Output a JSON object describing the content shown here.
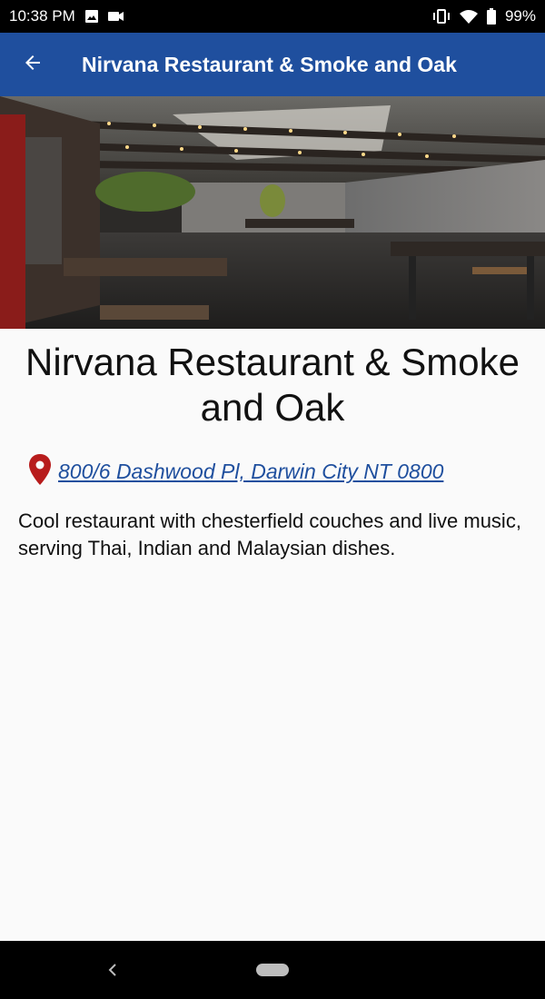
{
  "status_bar": {
    "time": "10:38 PM",
    "battery": "99%",
    "icons": [
      "image-icon",
      "video-icon",
      "vibrate-icon",
      "wifi-icon",
      "battery-icon"
    ]
  },
  "app_bar": {
    "title": "Nirvana Restaurant & Smoke and Oak",
    "back_icon": "arrow-left-icon",
    "color": "#1f4f9e"
  },
  "hero": {
    "icon": "restaurant-photo"
  },
  "place": {
    "name": "Nirvana Restaurant & Smoke and Oak",
    "address": "800/6 Dashwood Pl, Darwin City NT 0800",
    "address_icon": "map-pin-icon",
    "pin_color": "#b71c1c",
    "description": "Cool restaurant with chesterfield couches and live music, serving Thai, Indian and Malaysian dishes."
  },
  "nav_bar": {
    "icons": [
      "back-chevron-icon",
      "home-pill-icon"
    ]
  }
}
